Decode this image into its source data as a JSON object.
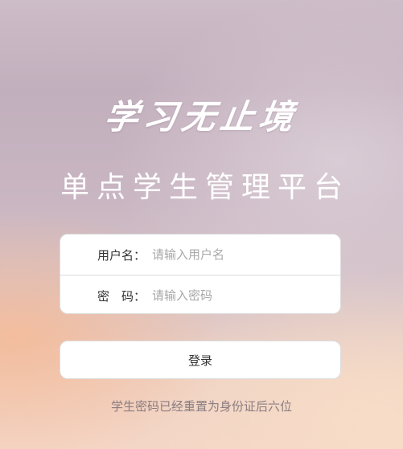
{
  "slogan": "学习无止境",
  "title": "单点学生管理平台",
  "login_form": {
    "username": {
      "label": "用户名：",
      "placeholder": "请输入用户名",
      "value": ""
    },
    "password": {
      "label": "密　码：",
      "placeholder": "请输入密码",
      "value": ""
    },
    "submit_label": "登录"
  },
  "hint": "学生密码已经重置为身份证后六位"
}
